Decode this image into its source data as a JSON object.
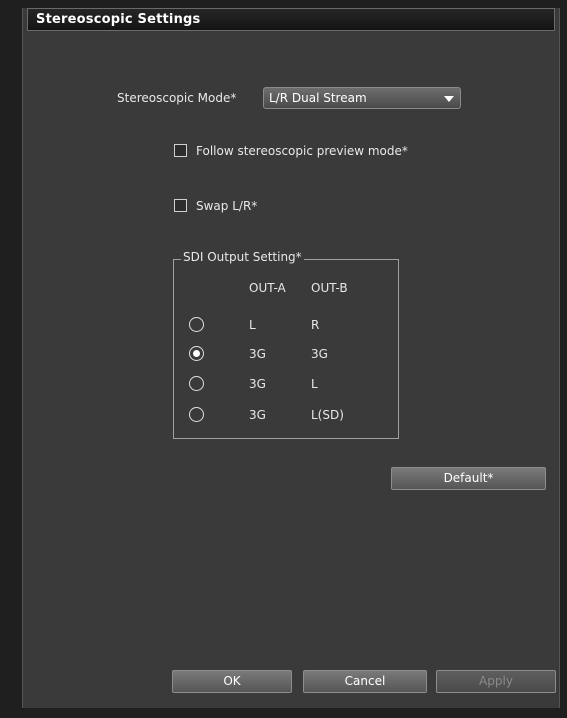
{
  "window": {
    "title": "Stereoscopic Settings"
  },
  "stereo_mode": {
    "label": "Stereoscopic Mode*",
    "value": "L/R Dual Stream"
  },
  "follow_preview": {
    "label": "Follow stereoscopic preview mode*",
    "checked": false
  },
  "swap_lr": {
    "label": "Swap L/R*",
    "checked": false
  },
  "sdi_output": {
    "title": "SDI Output Setting*",
    "col_a": "OUT-A",
    "col_b": "OUT-B",
    "options": [
      {
        "a": "L",
        "b": "R",
        "selected": false
      },
      {
        "a": "3G",
        "b": "3G",
        "selected": true
      },
      {
        "a": "3G",
        "b": "L",
        "selected": false
      },
      {
        "a": "3G",
        "b": "L(SD)",
        "selected": false
      }
    ]
  },
  "buttons": {
    "default_label": "Default*",
    "ok_label": "OK",
    "cancel_label": "Cancel",
    "apply_label": "Apply",
    "apply_enabled": false
  },
  "colors": {
    "panel_bg": "#3a3a3a",
    "title_bg": "#141414",
    "text": "#e8e8e8",
    "disabled_text": "#8a8a8a"
  }
}
